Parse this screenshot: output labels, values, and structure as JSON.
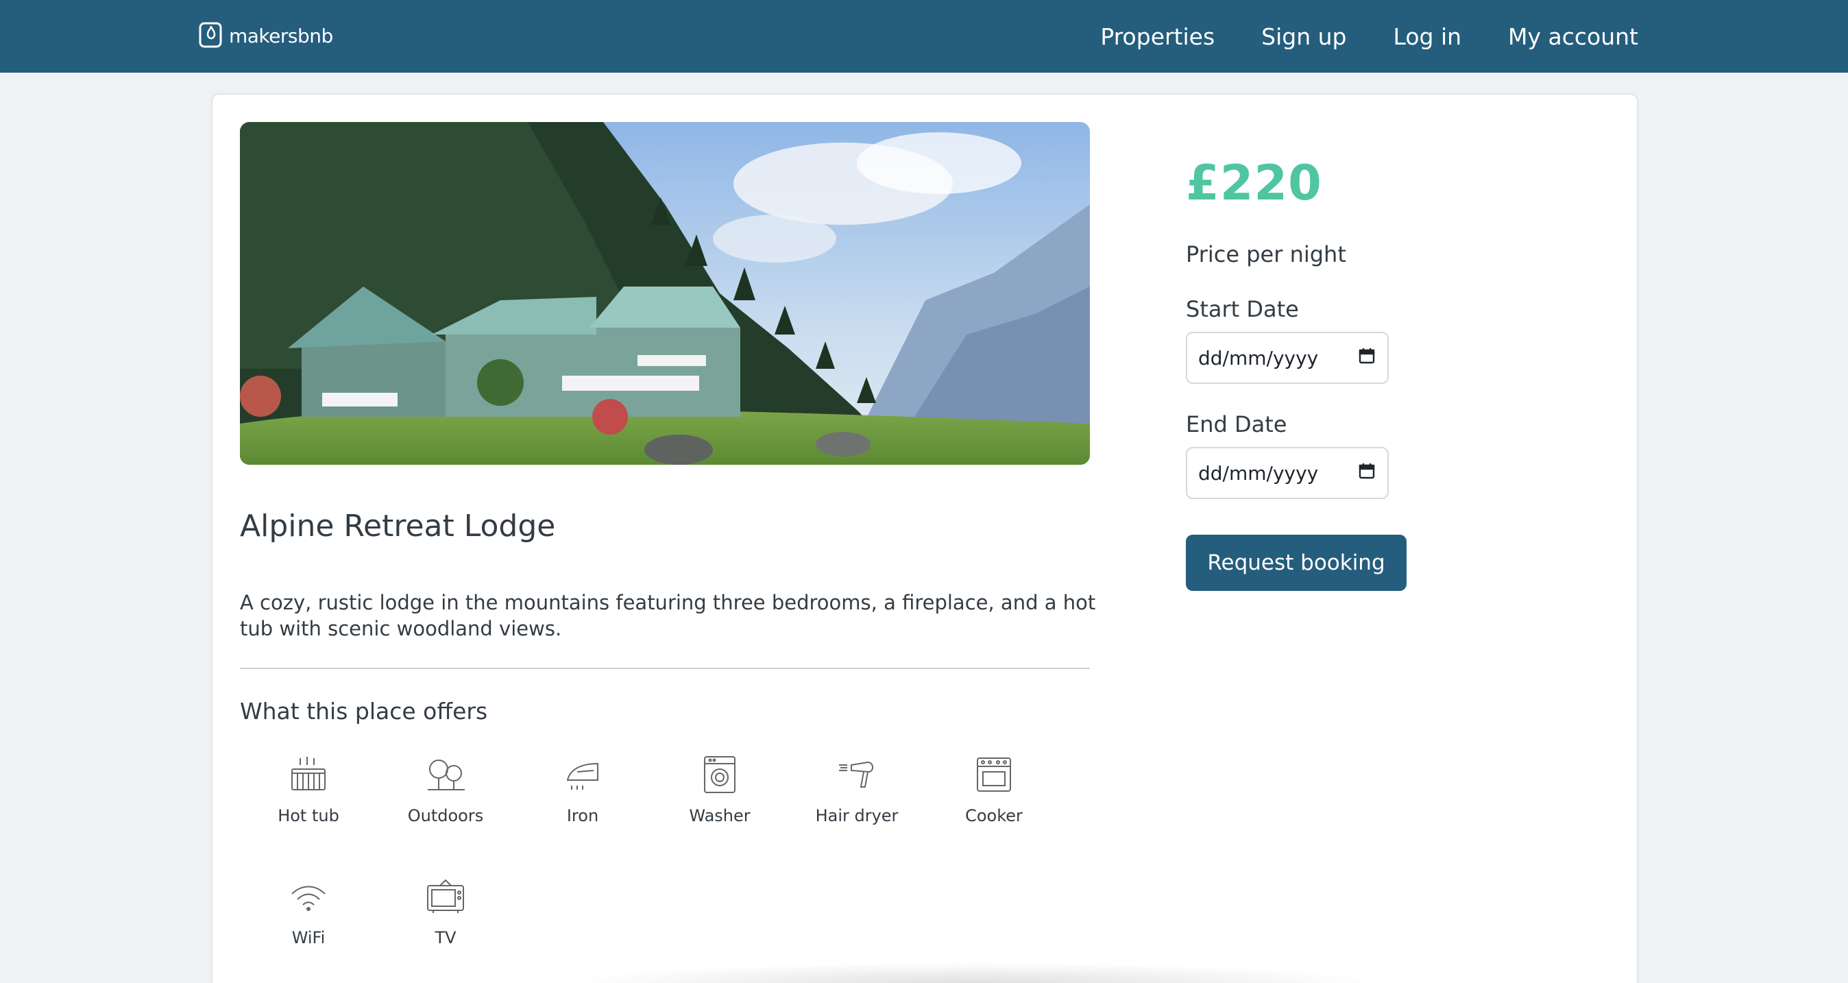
{
  "header": {
    "brand": "makersbnb",
    "nav": [
      {
        "label": "Properties"
      },
      {
        "label": "Sign up"
      },
      {
        "label": "Log in"
      },
      {
        "label": "My account"
      }
    ]
  },
  "listing": {
    "title": "Alpine Retreat Lodge",
    "description": "A cozy, rustic lodge in the mountains featuring three bedrooms, a fireplace, and a hot tub with scenic woodland views.",
    "offers_heading": "What this place offers",
    "amenities": [
      {
        "label": "Hot tub",
        "icon": "hot-tub-icon"
      },
      {
        "label": "Outdoors",
        "icon": "trees-icon"
      },
      {
        "label": "Iron",
        "icon": "iron-icon"
      },
      {
        "label": "Washer",
        "icon": "washer-icon"
      },
      {
        "label": "Hair dryer",
        "icon": "hair-dryer-icon"
      },
      {
        "label": "Cooker",
        "icon": "cooker-icon"
      },
      {
        "label": "WiFi",
        "icon": "wifi-icon"
      },
      {
        "label": "TV",
        "icon": "tv-icon"
      }
    ]
  },
  "booking": {
    "price": "£220",
    "price_label": "Price per night",
    "start_label": "Start Date",
    "end_label": "End Date",
    "date_placeholder": "dd/mm/yyyy",
    "button": "Request booking"
  },
  "colors": {
    "brand": "#255d7c",
    "accent": "#4fc5a1",
    "background": "#eef2f5"
  }
}
